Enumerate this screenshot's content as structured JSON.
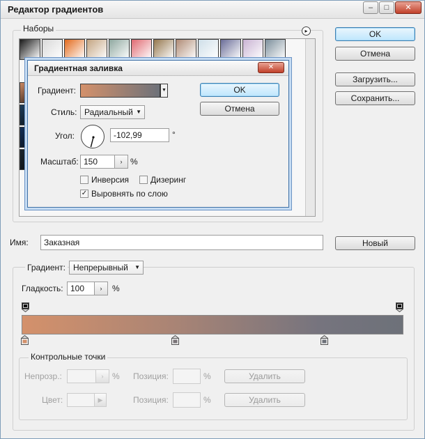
{
  "window": {
    "title": "Редактор градиентов",
    "caption_min": "–",
    "caption_max": "□",
    "caption_close": "✕"
  },
  "buttons": {
    "ok": "OK",
    "cancel": "Отмена",
    "load": "Загрузить...",
    "save": "Сохранить...",
    "new": "Новый"
  },
  "presets": {
    "label": "Наборы",
    "menu_icon": "▸",
    "row1": [
      "#1b1b1b",
      "#d9d9d9",
      "#e36b1e",
      "#c4a582",
      "#8fa8a0",
      "#e06a72",
      "#96784f",
      "#b08c76",
      "#cfdfe9",
      "#6b6e99",
      "#c9b3d3",
      "#7c8f9c"
    ],
    "left_swatches": [
      "#cc8a66",
      "#1d3d5c",
      "#12305a",
      "#1a2630"
    ]
  },
  "gradient_fill": {
    "title": "Градиентная заливка",
    "close": "✕",
    "gradient_label": "Градиент:",
    "gradient_colors": [
      "#d4916b",
      "#6d7179"
    ],
    "style_label": "Стиль:",
    "style_value": "Радиальный",
    "angle_label": "Угол:",
    "angle_value": "-102,99",
    "angle_unit": "°",
    "scale_label": "Масштаб:",
    "scale_value": "150",
    "scale_unit": "%",
    "invert_label": "Инверсия",
    "invert_checked": false,
    "dither_label": "Дизеринг",
    "dither_checked": false,
    "align_label": "Выровнять по слою",
    "align_checked": true,
    "ok": "OK",
    "cancel": "Отмена"
  },
  "name_row": {
    "label": "Имя:",
    "value": "Заказная"
  },
  "gradient_type": {
    "label": "Градиент:",
    "value": "Непрерывный",
    "smoothness_label": "Гладкость:",
    "smoothness_value": "100",
    "smoothness_unit": "%"
  },
  "gradient_bar": {
    "colors": [
      "#d4916b",
      "#a98475",
      "#76747e",
      "#6d7179"
    ],
    "opacity_stops": [
      0,
      1
    ],
    "color_stops": [
      0,
      0.395,
      0.785
    ]
  },
  "stops_group": {
    "label": "Контрольные точки",
    "opacity_label": "Непрозр.:",
    "opacity_unit": "%",
    "opacity_position_label": "Позиция:",
    "opacity_position_unit": "%",
    "opacity_delete": "Удалить",
    "color_label": "Цвет:",
    "color_position_label": "Позиция:",
    "color_position_unit": "%",
    "color_delete": "Удалить"
  }
}
